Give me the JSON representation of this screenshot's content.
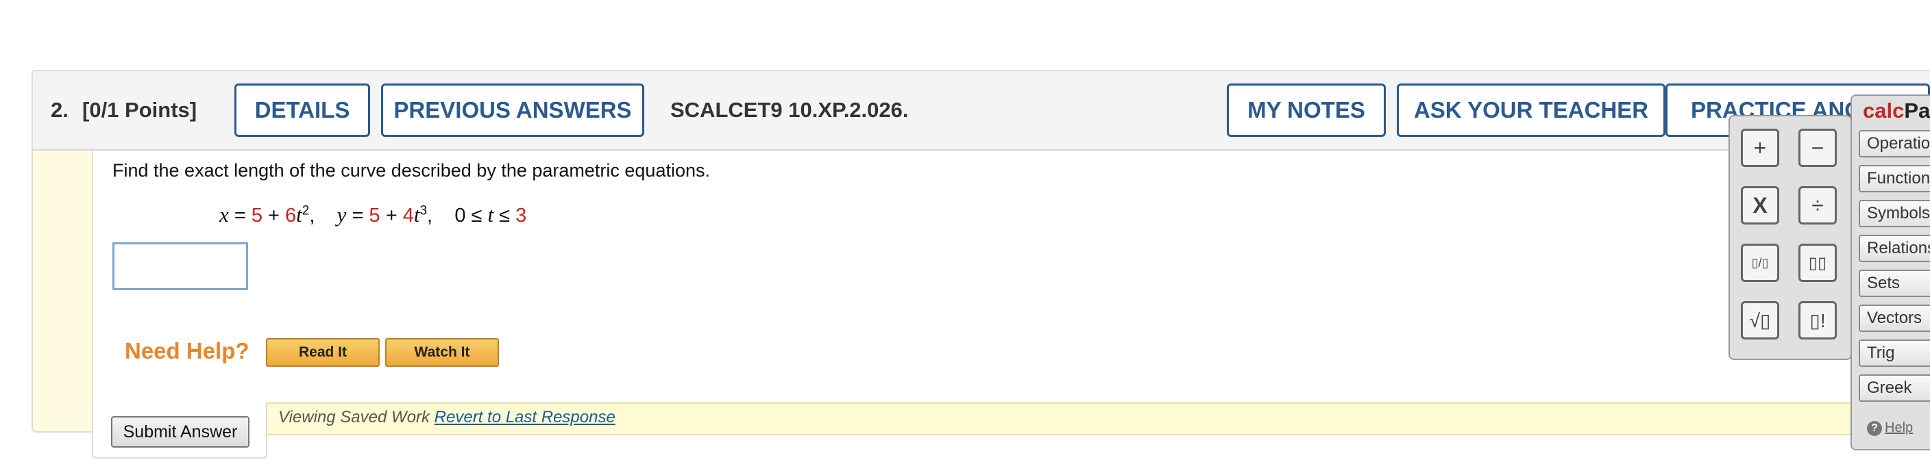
{
  "question": {
    "number": "2.",
    "points": "[0/1 Points]",
    "code": "SCALCET9 10.XP.2.026."
  },
  "header_buttons": {
    "details": "DETAILS",
    "previous_answers": "PREVIOUS ANSWERS",
    "my_notes": "MY NOTES",
    "ask_teacher": "ASK YOUR TEACHER",
    "practice": "PRACTICE ANOTHER"
  },
  "problem": {
    "prompt": "Find the exact length of the curve described by the parametric equations.",
    "x_const": "5",
    "x_coef": "6",
    "x_exp": "2",
    "y_const": "5",
    "y_coef": "4",
    "y_exp": "3",
    "t_upper": "3",
    "answer_value": ""
  },
  "help": {
    "label": "Need Help?",
    "read_it": "Read It",
    "watch_it": "Watch It"
  },
  "status": {
    "viewing": "Viewing Saved Work",
    "revert_link": "Revert to Last Response"
  },
  "submit_label": "Submit Answer",
  "calcpad": {
    "title_calc": "calc",
    "title_pad": "Pad",
    "keys": {
      "plus": "+",
      "minus": "−",
      "times": "X",
      "divide": "÷",
      "fraction": "▯/▯",
      "power": "▯▯",
      "sqrt": "√▯",
      "factorial": "▯!"
    },
    "categories": [
      "Operations",
      "Functions",
      "Symbols",
      "Relations",
      "Sets",
      "Vectors",
      "Trig",
      "Greek"
    ],
    "help_label": "Help"
  },
  "colors": {
    "accent_blue": "#2b5a8f",
    "highlight_red": "#cc1f1f",
    "help_orange": "#e8862a",
    "calc_red": "#c0272d"
  }
}
